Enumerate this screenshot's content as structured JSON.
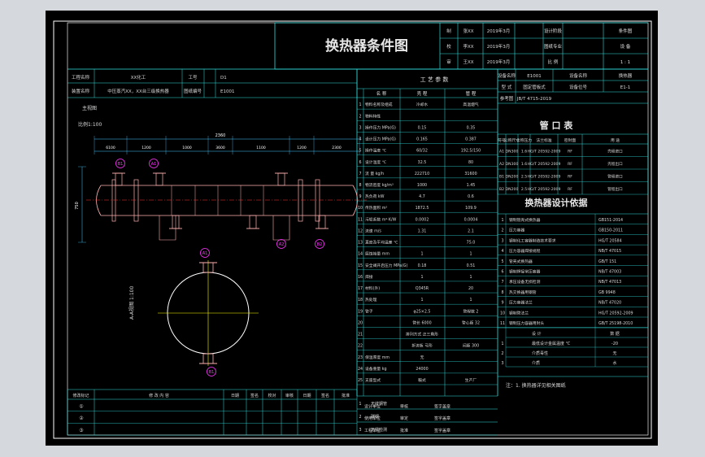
{
  "title_block": {
    "drawing_title": "换热器条件图",
    "rows": [
      [
        "制",
        "张XX",
        "2019年3月",
        "设计阶段",
        "条件图"
      ],
      [
        "校",
        "李XX",
        "2019年3月",
        "图纸专业",
        "设 备"
      ],
      [
        "审",
        "王XX",
        "2019年3月",
        "比 例",
        "1 : 1"
      ]
    ]
  },
  "project_info": {
    "rows": [
      [
        "工程名称",
        "XX化工",
        "工号",
        "D1"
      ],
      [
        "装置名称",
        "中压蒸汽XX，XX台三级换热器",
        "图纸编号",
        "E1001"
      ]
    ]
  },
  "equipment_info": {
    "rows": [
      [
        "设备名称",
        "E1001",
        "设备名称",
        "换热器"
      ],
      [
        "型 式",
        "固定管板式",
        "设备位号",
        "E1-1"
      ],
      [
        "参考图",
        "JB/T 4715-2019",
        ""
      ]
    ]
  },
  "process_params": {
    "heading": "工 艺 参 数",
    "cols": [
      "名 称",
      "壳 程",
      "管 程"
    ],
    "rows": [
      [
        "1",
        "物料名称及组成",
        "冷却水",
        "高温烟气"
      ],
      [
        "2",
        "物料特性",
        "",
        ""
      ],
      [
        "3",
        "操作压力 MPa(G)",
        "0.15",
        "0.35"
      ],
      [
        "4",
        "设计压力 MPa(G)",
        "0.165",
        "0.387"
      ],
      [
        "5",
        "操作温度 ℃",
        "60/32",
        "192.5/150"
      ],
      [
        "6",
        "设计温度 ℃",
        "32.5",
        "80"
      ],
      [
        "7",
        "流 量 kg/h",
        "222710",
        "31600"
      ],
      [
        "8",
        "物流密度 kg/m³",
        "1000",
        "1.45"
      ],
      [
        "9",
        "热负荷 kW",
        "4.7",
        "0.6"
      ],
      [
        "10",
        "传热面积 m²",
        "1872.5",
        "109.9"
      ],
      [
        "11",
        "污垢系数 m²·K/W",
        "0.0002",
        "0.0004"
      ],
      [
        "12",
        "流速 m/s",
        "1.31",
        "2.1"
      ],
      [
        "13",
        "直度及平均温差 ℃",
        "",
        "75.0"
      ],
      [
        "14",
        "腐蚀裕量 mm",
        "1",
        "1"
      ],
      [
        "15",
        "安全阀开启压力 MPa(G)",
        "0.18",
        "0.51"
      ],
      [
        "16",
        "焊接",
        "1",
        "1"
      ],
      [
        "17",
        "材料(外)",
        "Q345R",
        "20"
      ],
      [
        "18",
        "热处理",
        "1",
        "1"
      ],
      [
        "19",
        "管子",
        "φ25×2.5",
        "管程数 2"
      ],
      [
        "20",
        "",
        "管长 6000",
        "管心距 32"
      ],
      [
        "21",
        "",
        "排列方式 正三角形",
        ""
      ],
      [
        "22",
        "",
        "折流板 弓形",
        "间距 300"
      ],
      [
        "23",
        "保温厚度 mm",
        "无",
        ""
      ],
      [
        "24",
        "设备重量 kg",
        "24000",
        ""
      ],
      [
        "25",
        "支座型式",
        "鞍式",
        "生产厂"
      ]
    ],
    "footer": [
      [
        "1",
        "无缝钢管"
      ],
      [
        "2",
        "碳钢"
      ],
      [
        "3",
        "无损检测"
      ]
    ]
  },
  "nozzles": {
    "heading": "管 口 表",
    "cols": [
      "符号",
      "公称尺寸",
      "公称压力",
      "法兰标准",
      "密封面",
      "用 途"
    ],
    "rows": [
      [
        "A1",
        "DN300",
        "1.6",
        "HG/T 20592-2009",
        "RF",
        "壳程进口"
      ],
      [
        "A2",
        "DN300",
        "1.6",
        "HG/T 20592-2009",
        "RF",
        "壳程出口"
      ],
      [
        "B1",
        "DN200",
        "2.5",
        "HG/T 20592-2009",
        "RF",
        "管程进口"
      ],
      [
        "B2",
        "DN200",
        "2.5",
        "HG/T 20592-2009",
        "RF",
        "管程出口"
      ]
    ]
  },
  "standards": {
    "heading": "换热器设计依据",
    "rows": [
      [
        "1",
        "钢制管壳式换热器",
        "GB151-2014"
      ],
      [
        "2",
        "压力容器",
        "GB150-2011"
      ],
      [
        "3",
        "钢制化工容器制造技术要求",
        "HG/T 20584"
      ],
      [
        "4",
        "压力容器焊接规程",
        "NB/T 47015"
      ],
      [
        "5",
        "管壳式换热器",
        "GB/T 151"
      ],
      [
        "6",
        "钢制焊接常压容器",
        "NB/T 47003"
      ],
      [
        "7",
        "承压设备无损检测",
        "NB/T 47013"
      ],
      [
        "8",
        "热交换器用钢管",
        "GB 9948"
      ],
      [
        "9",
        "压力容器法兰",
        "NB/T 47020"
      ],
      [
        "10",
        "钢制管法兰",
        "HG/T 20592-2009"
      ],
      [
        "11",
        "钢制压力容器用封头",
        "GB/T 25198-2010"
      ]
    ]
  },
  "design_box": {
    "rows": [
      [
        "",
        "设 计",
        "数 据"
      ],
      [
        "1",
        "最低设计金属温度 ℃",
        "-20"
      ],
      [
        "2",
        "介质毒性",
        "无"
      ],
      [
        "3",
        "介质",
        "水"
      ]
    ],
    "note": "注：1. 换热器详见相关图纸"
  },
  "revision_table": {
    "cols": [
      "修改标记",
      "修 改 内 容",
      "日期",
      "签名",
      "校对",
      "审核",
      "日期",
      "签名",
      "批准"
    ],
    "rows": [
      [
        "①"
      ],
      [
        "②"
      ],
      [
        "③"
      ]
    ]
  },
  "approval": {
    "rows": [
      [
        "设计单位",
        "审核",
        "签字盖章"
      ],
      [
        "使用单位",
        "审定",
        "签字盖章"
      ],
      [
        "工程单位",
        "批准",
        "签字盖章"
      ]
    ]
  },
  "elevation_view": {
    "label": "主视图",
    "scale_label": "比例1:100",
    "dims": [
      "2360",
      "6100",
      "1200",
      "1000",
      "3600",
      "1100",
      "1200",
      "2300",
      "2150",
      "1200"
    ],
    "vertical_dim": "750",
    "nozzle_tags": [
      "B1",
      "A1",
      "A2",
      "B2"
    ]
  },
  "end_view": {
    "label": "A-A视图 1:100",
    "nozzle_tags": [
      "A1",
      "B1"
    ]
  },
  "colors": {
    "frame": "#ffffff",
    "table_lines": "#2fe0e0",
    "vessel": "#ffb0b0",
    "dimension": "#44c8ff",
    "centerline": "#ff3333",
    "tag": "#ff33ff",
    "axis": "#ffff00"
  }
}
